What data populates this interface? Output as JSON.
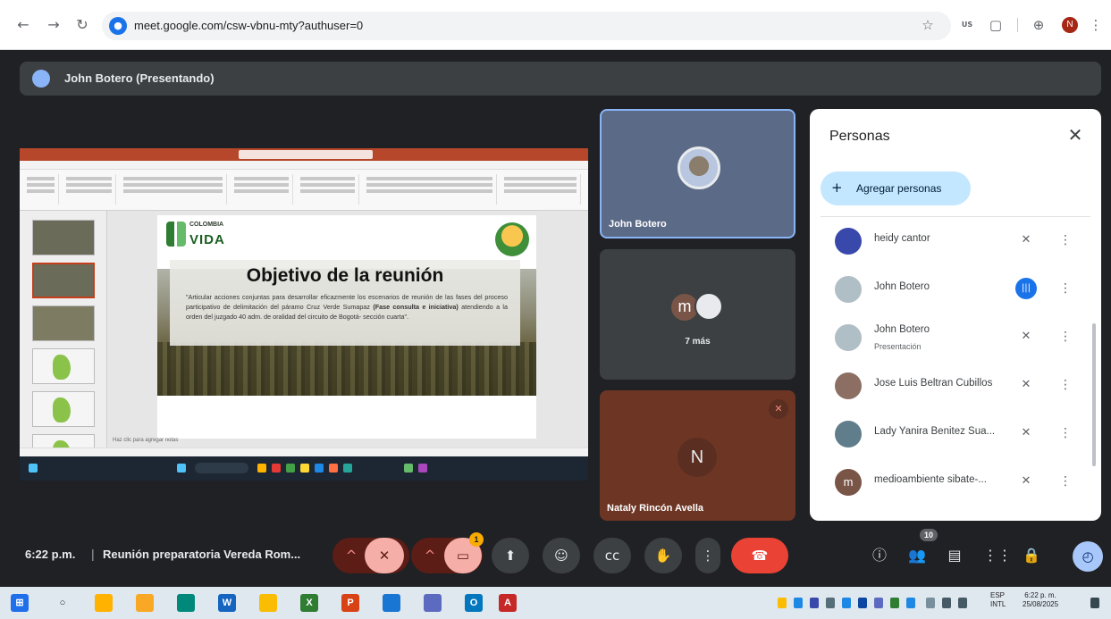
{
  "browser": {
    "url": "meet.google.com/csw-vbnu-mty?authuser=0",
    "profile_initial": "N",
    "ext_badge": "US"
  },
  "presenter_banner": "John Botero (Presentando)",
  "slide": {
    "logo_top": "COLOMBIA",
    "logo_main": "VIDA",
    "title": "Objetivo de la reunión",
    "body_prefix": "\"Articular acciones conjuntas para desarrollar eficazmente los escenarios de reunión de las fases del proceso participativo de delimitación del páramo Cruz Verde Sumapaz ",
    "body_bold": "(Fase consulta e iniciativa)",
    "body_suffix": " atendiendo a la orden del juzgado 40 adm. de oralidad del circuito de Bogotá- sección cuarta\".",
    "notes": "Haz clic para agregar notas"
  },
  "tiles": {
    "t1_name": "John Botero",
    "t2_initial": "m",
    "t2_more": "7 más",
    "t3_initial": "N",
    "t3_name": "Nataly Rincón Avella"
  },
  "panel": {
    "title": "Personas",
    "add_label": "Agregar personas",
    "participants": [
      {
        "name": "heidy cantor",
        "sub": "",
        "initial": ""
      },
      {
        "name": "John Botero",
        "sub": "",
        "initial": ""
      },
      {
        "name": "John Botero",
        "sub": "Presentación",
        "initial": ""
      },
      {
        "name": "Jose Luis Beltran Cubillos",
        "sub": "",
        "initial": ""
      },
      {
        "name": "Lady Yanira Benitez Sua...",
        "sub": "",
        "initial": ""
      },
      {
        "name": "medioambiente sibate-...",
        "sub": "",
        "initial": "m"
      }
    ]
  },
  "controls": {
    "time": "6:22 p.m.",
    "meeting_name": "Reunión preparatoria Vereda Rom...",
    "camera_badge": "1",
    "people_count": "10"
  },
  "taskbar": {
    "lang1": "ESP",
    "lang2": "INTL",
    "time": "6:22 p. m.",
    "date": "25/08/2025"
  }
}
